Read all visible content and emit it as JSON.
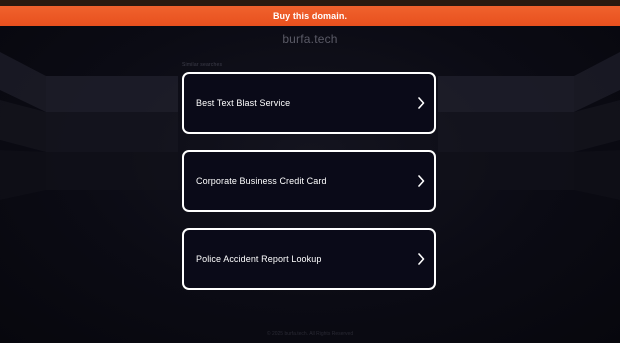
{
  "buy_bar": {
    "label": "Buy this domain."
  },
  "domain": {
    "name": "burfa.tech"
  },
  "related": {
    "label": "Similar searches",
    "items": [
      {
        "label": "Best Text Blast Service"
      },
      {
        "label": "Corporate Business Credit Card"
      },
      {
        "label": "Police Accident Report Lookup"
      }
    ]
  },
  "footer": {
    "text": "© 2025 burfa.tech. All Rights Reserved"
  },
  "colors": {
    "accent": "#e8501e",
    "background": "#0a0a12",
    "card_border": "#ffffff"
  },
  "icons": {
    "card_chevron": "chevron-right-icon"
  }
}
